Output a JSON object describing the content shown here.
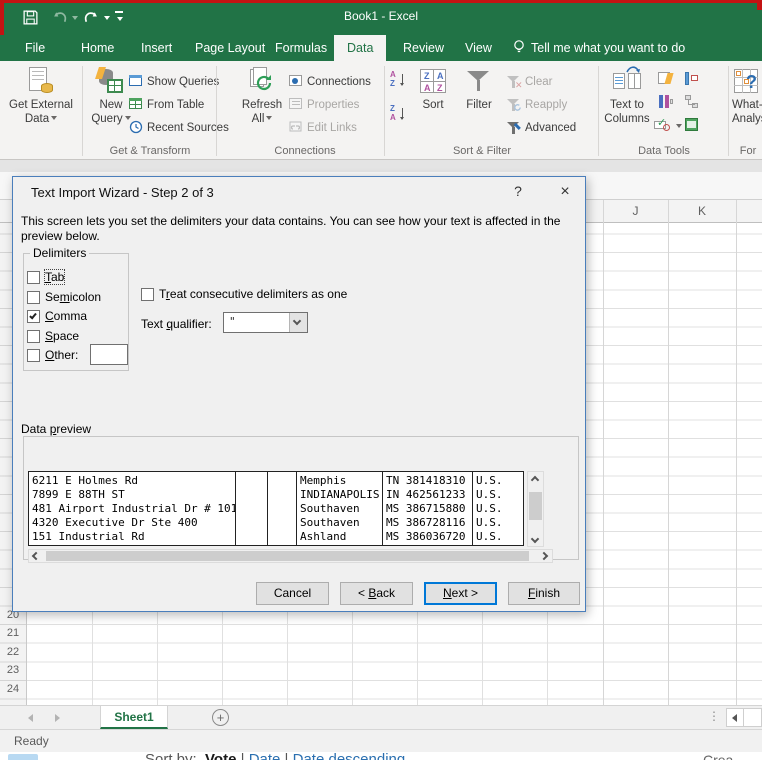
{
  "titlebar": {
    "title": "Book1 - Excel"
  },
  "tabs": {
    "items": [
      "File",
      "Home",
      "Insert",
      "Page Layout",
      "Formulas",
      "Data",
      "Review",
      "View"
    ],
    "tell_me": "Tell me what you want to do"
  },
  "ribbon": {
    "get_external_line1": "Get External",
    "get_external_line2": "Data",
    "new_query_line1": "New",
    "new_query_line2": "Query",
    "show_queries": "Show Queries",
    "from_table": "From Table",
    "recent_sources": "Recent Sources",
    "refresh_line1": "Refresh",
    "refresh_line2": "All",
    "connections": "Connections",
    "properties": "Properties",
    "edit_links": "Edit Links",
    "sort": "Sort",
    "filter": "Filter",
    "clear": "Clear",
    "reapply": "Reapply",
    "advanced": "Advanced",
    "ttc_line1": "Text to",
    "ttc_line2": "Columns",
    "whatif_line1": "What-If",
    "whatif_line2": "Analysis",
    "groups": {
      "get_transform": "Get & Transform",
      "connections": "Connections",
      "sort_filter": "Sort & Filter",
      "data_tools": "Data Tools",
      "forecast": "For"
    }
  },
  "dialog": {
    "title": "Text Import Wizard - Step 2 of 3",
    "help": "?",
    "close": "×",
    "description": "This screen lets you set the delimiters your data contains.  You can see how your text is affected in the preview below.",
    "delimiters_legend": "Delimiters",
    "options": [
      {
        "pre": "",
        "key": "T",
        "post": "ab",
        "checked": false
      },
      {
        "pre": "Se",
        "key": "m",
        "post": "icolon",
        "checked": false
      },
      {
        "pre": "",
        "key": "C",
        "post": "omma",
        "checked": true
      },
      {
        "pre": "",
        "key": "S",
        "post": "pace",
        "checked": false
      },
      {
        "pre": "",
        "key": "O",
        "post": "ther:",
        "checked": false
      }
    ],
    "treat": {
      "pre": "T",
      "key": "r",
      "post": "eat consecutive delimiters as one",
      "checked": false
    },
    "qualifier": {
      "pre": "Text ",
      "key": "q",
      "post": "ualifier:"
    },
    "qualifier_value": "\"",
    "preview_label": {
      "pre": "Data ",
      "key": "p",
      "post": "review"
    },
    "preview": {
      "columns": [
        {
          "lines": [
            "6211 E Holmes Rd",
            "7899 E 88TH ST",
            "481 Airport Industrial Dr # 101",
            "4320 Executive Dr Ste 400",
            "151 Industrial Rd"
          ]
        },
        {
          "lines": [
            "",
            "",
            "",
            "",
            ""
          ]
        },
        {
          "lines": [
            "",
            "",
            "",
            "",
            ""
          ]
        },
        {
          "lines": [
            "Memphis",
            "INDIANAPOLIS",
            "Southaven",
            "Southaven",
            "Ashland"
          ]
        },
        {
          "lines": [
            "TN 381418310",
            "IN 462561233",
            "MS 386715880",
            "MS 386728116",
            "MS 386036720"
          ]
        },
        {
          "lines": [
            "U.S.",
            "U.S.",
            "U.S.",
            "U.S.",
            "U.S."
          ]
        }
      ]
    },
    "buttons": {
      "cancel": {
        "pre": "Cancel",
        "key": "",
        "post": ""
      },
      "back": {
        "pre": "< ",
        "key": "B",
        "post": "ack"
      },
      "next": {
        "pre": "",
        "key": "N",
        "post": "ext >"
      },
      "finish": {
        "pre": "",
        "key": "F",
        "post": "inish"
      }
    }
  },
  "sheet": {
    "columns": [
      "J",
      "K"
    ],
    "rows": [
      "20",
      "21",
      "22",
      "23",
      "24"
    ],
    "tab_name": "Sheet1",
    "status": "Ready"
  },
  "page_behind": {
    "sort_by": "Sort by:",
    "vote": "Vote",
    "pipe1": "|",
    "date": "Date",
    "pipe2": "|",
    "date_desc": "Date descending",
    "crea": "Crea"
  },
  "colors": {
    "excel_green": "#217346",
    "dialog_border": "#4a7ebb",
    "default_button_blue": "#0078d7",
    "capture_border_red": "#c31313"
  }
}
